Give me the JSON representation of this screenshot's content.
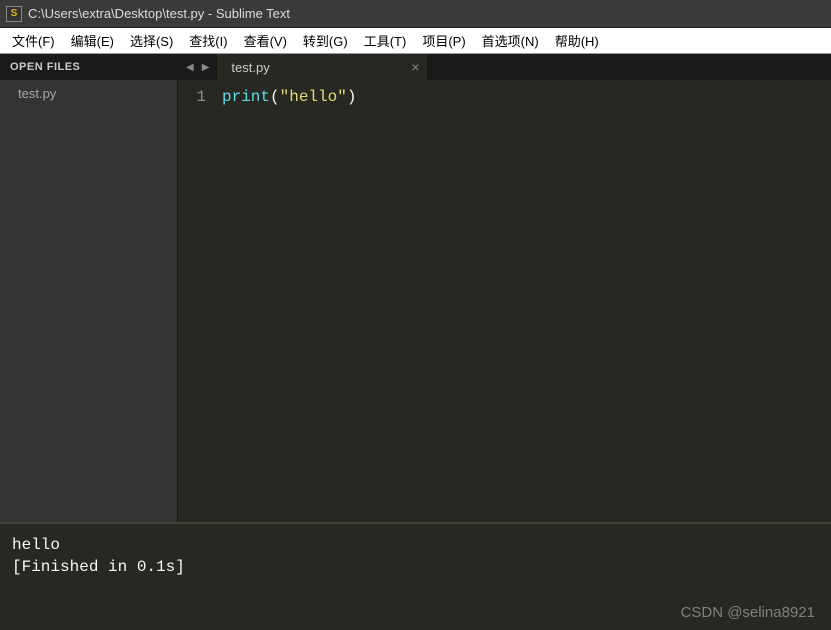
{
  "titlebar": {
    "app_icon_letter": "S",
    "title": "C:\\Users\\extra\\Desktop\\test.py - Sublime Text"
  },
  "menu": {
    "items": [
      "文件(F)",
      "编辑(E)",
      "选择(S)",
      "查找(I)",
      "查看(V)",
      "转到(G)",
      "工具(T)",
      "项目(P)",
      "首选项(N)",
      "帮助(H)"
    ]
  },
  "sidebar": {
    "header": "OPEN FILES",
    "files": [
      "test.py"
    ]
  },
  "tabs": {
    "items": [
      {
        "label": "test.py",
        "active": true
      }
    ]
  },
  "editor": {
    "lines": [
      "1"
    ],
    "code_tokens": [
      {
        "t": "print",
        "c": "tok-func"
      },
      {
        "t": "(",
        "c": "tok-punc"
      },
      {
        "t": "\"hello\"",
        "c": "tok-str"
      },
      {
        "t": ")",
        "c": "tok-punc"
      }
    ]
  },
  "console": {
    "output": "hello",
    "status": "[Finished in 0.1s]"
  },
  "watermark": "CSDN @selina8921"
}
